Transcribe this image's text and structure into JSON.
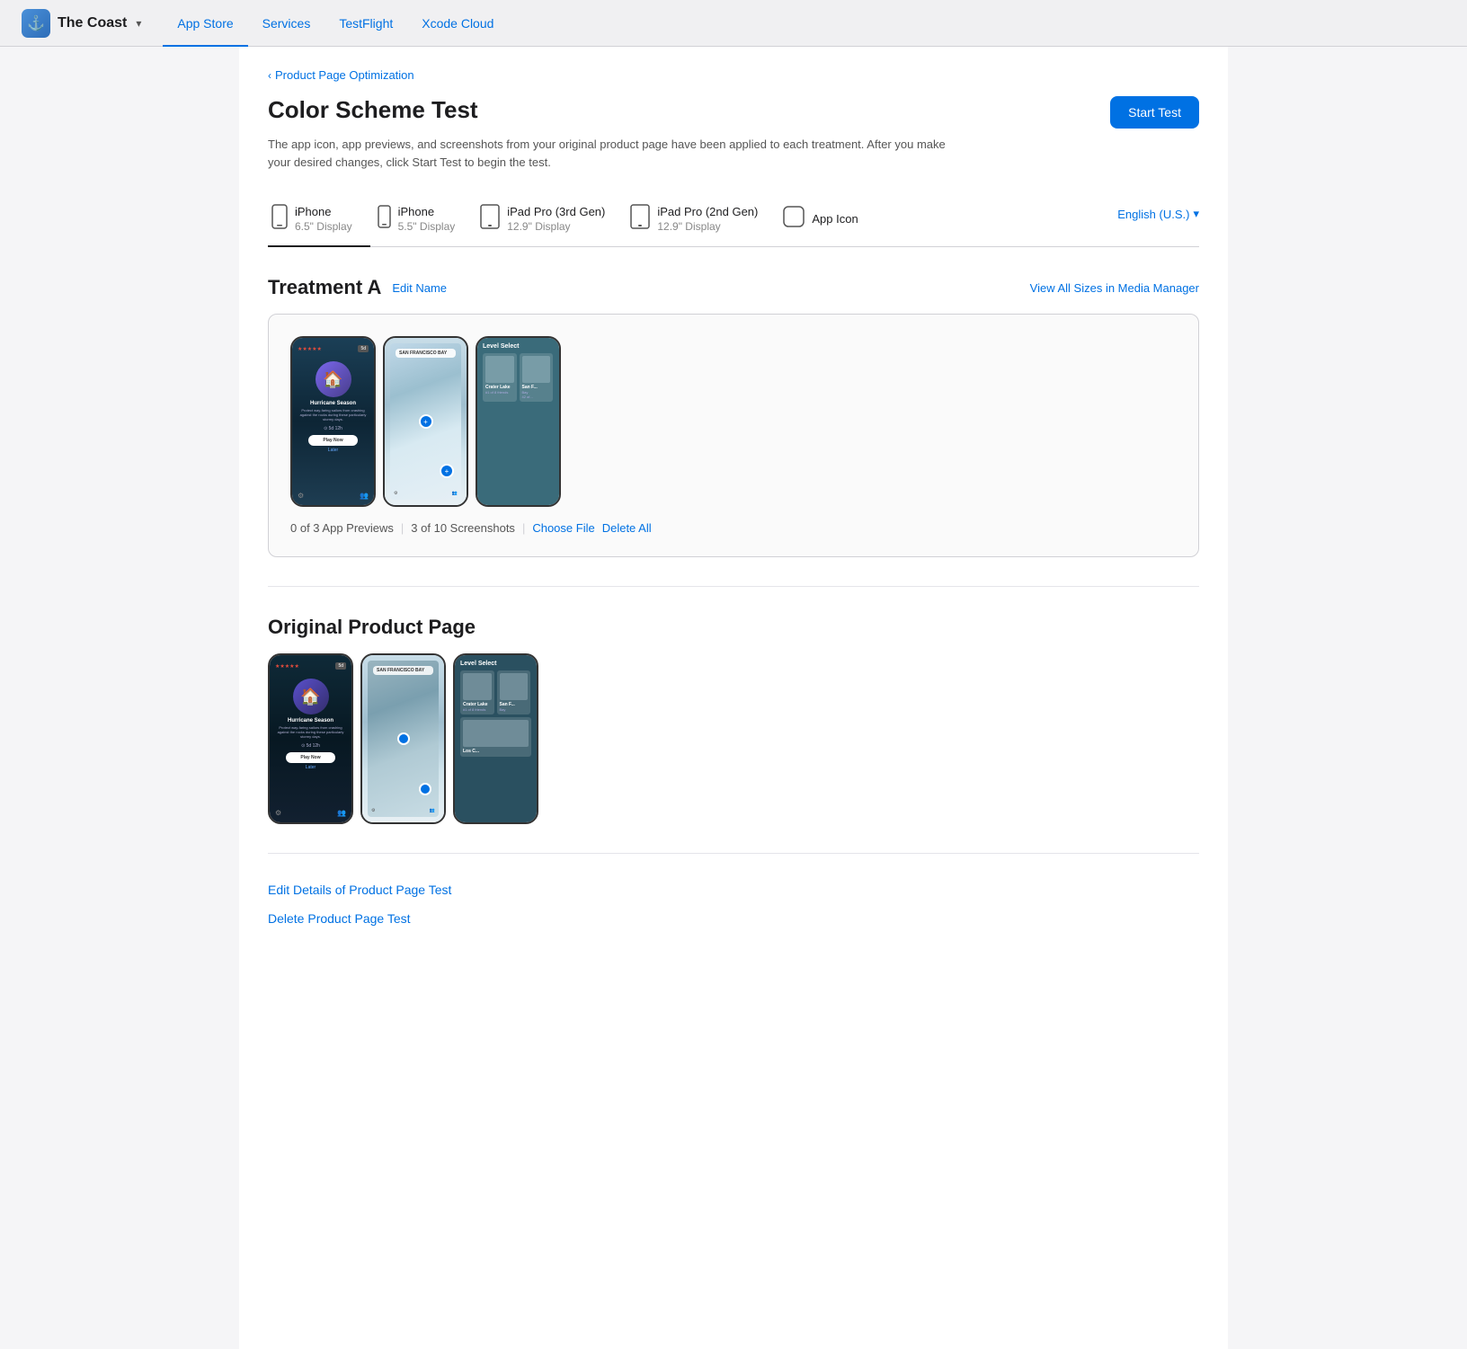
{
  "nav": {
    "brand": "The Coast",
    "brand_icon": "🌊",
    "links": [
      "App Store",
      "Services",
      "TestFlight",
      "Xcode Cloud"
    ],
    "active_link": "App Store"
  },
  "breadcrumb": {
    "label": "Product Page Optimization",
    "chevron": "‹"
  },
  "header": {
    "title": "Color Scheme Test",
    "description": "The app icon, app previews, and screenshots from your original product page have been applied to each treatment. After you make your desired changes, click Start Test to begin the test.",
    "start_test_button": "Start Test"
  },
  "device_tabs": [
    {
      "name": "iPhone",
      "size": "6.5\" Display",
      "active": true
    },
    {
      "name": "iPhone",
      "size": "5.5\" Display",
      "active": false
    },
    {
      "name": "iPad Pro (3rd Gen)",
      "size": "12.9\" Display",
      "active": false
    },
    {
      "name": "iPad Pro (2nd Gen)",
      "size": "12.9\" Display",
      "active": false
    },
    {
      "name": "App Icon",
      "size": "",
      "active": false
    }
  ],
  "language": "English (U.S.)",
  "treatment_a": {
    "title": "Treatment A",
    "edit_name": "Edit Name",
    "view_all": "View All Sizes in Media Manager",
    "previews_count": "0 of 3 App Previews",
    "screenshots_count": "3  of 10 Screenshots",
    "choose_file": "Choose File",
    "delete_all": "Delete All"
  },
  "original_page": {
    "title": "Original Product Page"
  },
  "bottom_links": [
    "Edit Details of Product Page Test",
    "Delete Product Page Test"
  ]
}
